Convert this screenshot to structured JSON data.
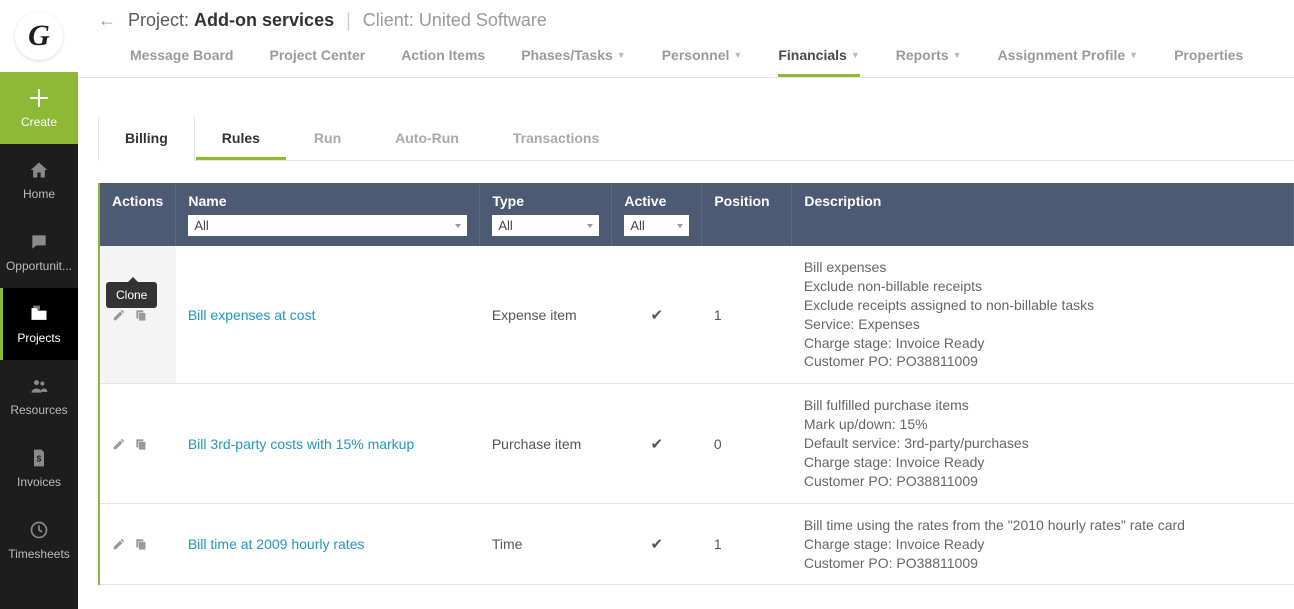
{
  "brand": {
    "letter": "G"
  },
  "leftnav": {
    "create": "Create",
    "items": [
      {
        "label": "Home"
      },
      {
        "label": "Opportunit..."
      },
      {
        "label": "Projects",
        "active": true
      },
      {
        "label": "Resources"
      },
      {
        "label": "Invoices"
      },
      {
        "label": "Timesheets"
      }
    ]
  },
  "breadcrumb": {
    "project_label": "Project:",
    "project_name": "Add-on services",
    "client_label": "Client:",
    "client_name": "United Software"
  },
  "topnav": [
    {
      "label": "Message Board"
    },
    {
      "label": "Project Center"
    },
    {
      "label": "Action Items"
    },
    {
      "label": "Phases/Tasks",
      "dropdown": true
    },
    {
      "label": "Personnel",
      "dropdown": true
    },
    {
      "label": "Financials",
      "dropdown": true,
      "active": true
    },
    {
      "label": "Reports",
      "dropdown": true
    },
    {
      "label": "Assignment Profile",
      "dropdown": true
    },
    {
      "label": "Properties"
    }
  ],
  "subtabs": [
    {
      "label": "Billing",
      "current": true
    },
    {
      "label": "Rules",
      "active": true
    },
    {
      "label": "Run"
    },
    {
      "label": "Auto-Run"
    },
    {
      "label": "Transactions"
    }
  ],
  "table": {
    "headers": {
      "actions": "Actions",
      "name": "Name",
      "type": "Type",
      "active": "Active",
      "position": "Position",
      "description": "Description"
    },
    "filters": {
      "name": "All",
      "type": "All",
      "active": "All"
    },
    "tooltip": "Clone",
    "rows": [
      {
        "name": "Bill expenses at cost",
        "type": "Expense item",
        "active": true,
        "position": "1",
        "description": [
          "Bill expenses",
          "Exclude non-billable receipts",
          "Exclude receipts assigned to non-billable tasks",
          "Service: Expenses",
          "Charge stage: Invoice Ready",
          "Customer PO: PO38811009"
        ]
      },
      {
        "name": "Bill 3rd-party costs with 15% markup",
        "type": "Purchase item",
        "active": true,
        "position": "0",
        "description": [
          "Bill fulfilled purchase items",
          "Mark up/down: 15%",
          "Default service: 3rd-party/purchases",
          "Charge stage: Invoice Ready",
          "Customer PO: PO38811009"
        ]
      },
      {
        "name": "Bill time at 2009 hourly rates",
        "type": "Time",
        "active": true,
        "position": "1",
        "description": [
          "Bill time using the rates from the \"2010 hourly rates\" rate card",
          "Charge stage: Invoice Ready",
          "Customer PO: PO38811009"
        ]
      }
    ]
  }
}
